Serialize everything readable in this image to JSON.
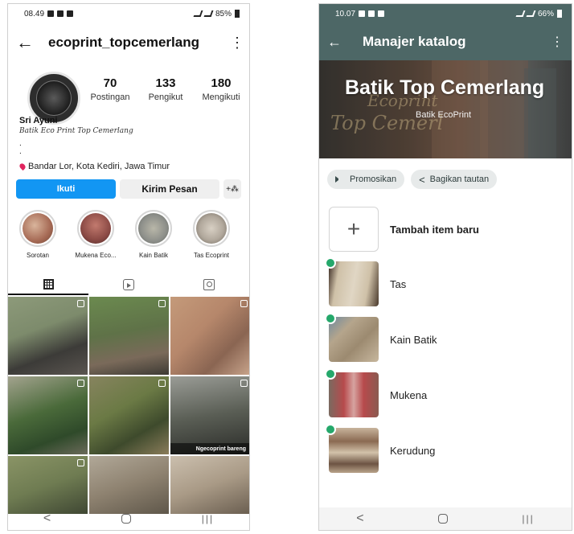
{
  "instagram": {
    "status_bar": {
      "time": "08.49",
      "battery": "85%"
    },
    "username": "ecoprint_topcemerlang",
    "stats": [
      {
        "value": "70",
        "label": "Postingan"
      },
      {
        "value": "133",
        "label": "Pengikut"
      },
      {
        "value": "180",
        "label": "Mengikuti"
      }
    ],
    "name": "Sri Ayuni",
    "bio": "Batik Eco Print Top Cemerlang",
    "bio_dot_1": ".",
    "bio_dot_2": ".",
    "location": "Bandar Lor, Kota Kediri, Jawa Timur",
    "buttons": {
      "follow": "Ikuti",
      "message": "Kirim Pesan",
      "add_user": "+⁂"
    },
    "highlights": [
      {
        "label": "Sorotan",
        "color": "#a66a55"
      },
      {
        "label": "Mukena Eco...",
        "color": "#8b4a45"
      },
      {
        "label": "Kain Batik",
        "color": "#8d8f8a"
      },
      {
        "label": "Tas Ecoprint",
        "color": "#b1a89c"
      }
    ],
    "post_caption": "Ngecoprint bareng",
    "post_colors": [
      "#7d8b6c",
      "#5f7248",
      "#b6876b",
      "#4a6a3a",
      "#6b7a45",
      "#5a5e55",
      "#6f7c52",
      "#8e8270",
      "#a99a86"
    ]
  },
  "catalog": {
    "status_bar": {
      "time": "10.07",
      "battery": "66%"
    },
    "title": "Manajer katalog",
    "business_name": "Batik Top Cemerlang",
    "business_category": "Batik EcoPrint",
    "actions": {
      "promote": "Promosikan",
      "share": "Bagikan tautan"
    },
    "add_item": "Tambah item baru",
    "items": [
      {
        "label": "Tas",
        "color": "#cfc1a8"
      },
      {
        "label": "Kain Batik",
        "color": "#9c8a70"
      },
      {
        "label": "Mukena",
        "color": "#b74a4c"
      },
      {
        "label": "Kerudung",
        "color": "#8a6a52"
      }
    ]
  }
}
